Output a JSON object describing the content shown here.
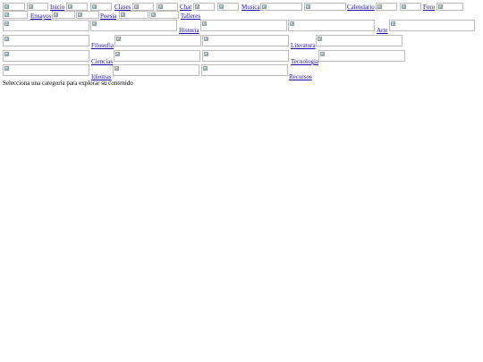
{
  "nav": {
    "inicio": "Inicio",
    "clases": "Clases",
    "chat": "Chat",
    "musica": "Musica",
    "calendario": "Calendario",
    "foro": "Foro",
    "ensayos": "Ensayos",
    "poesia": "Poesia",
    "talleres": "Talleres"
  },
  "categories": {
    "historia": "Historia",
    "arte": "Arte",
    "filosofia": "Filosofia",
    "literatura": "Literatura",
    "ciencias": "Ciencias",
    "tecnologia": "Tecnologia",
    "idiomas": "Idiomas",
    "recursos": "Recursos"
  },
  "status_text": "Selecciona una categoria para explorar su contenido",
  "icons": {
    "broken_image": "broken-image-icon"
  },
  "colors": {
    "link": "#1a0dab",
    "image_border": "#bcbcbc",
    "text": "#000000"
  }
}
